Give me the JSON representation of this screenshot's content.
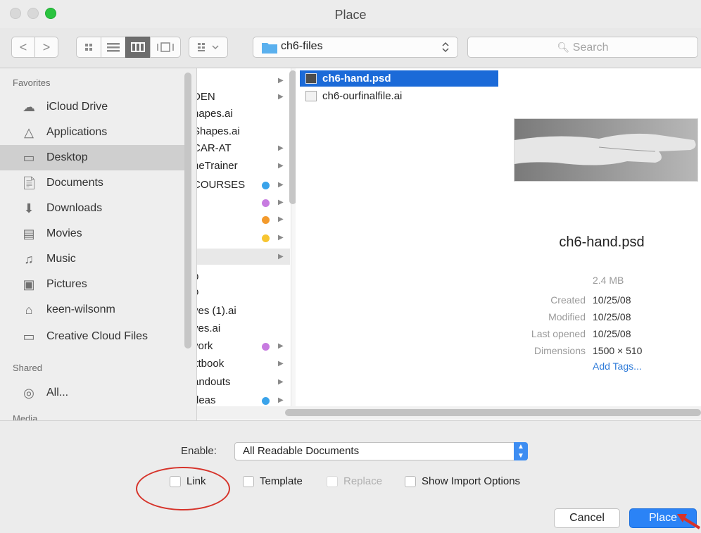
{
  "window": {
    "title": "Place"
  },
  "toolbar": {
    "back": "<",
    "forward": ">",
    "path": "ch6-files",
    "search_placeholder": "Search"
  },
  "sidebar": {
    "favorites_header": "Favorites",
    "favorites": [
      {
        "label": "iCloud Drive",
        "icon": "cloud-icon"
      },
      {
        "label": "Applications",
        "icon": "applications-icon"
      },
      {
        "label": "Desktop",
        "icon": "desktop-icon",
        "selected": true
      },
      {
        "label": "Documents",
        "icon": "documents-icon"
      },
      {
        "label": "Downloads",
        "icon": "downloads-icon"
      },
      {
        "label": "Movies",
        "icon": "movies-icon"
      },
      {
        "label": "Music",
        "icon": "music-icon"
      },
      {
        "label": "Pictures",
        "icon": "pictures-icon"
      },
      {
        "label": "keen-wilsonm",
        "icon": "home-icon"
      },
      {
        "label": "Creative Cloud Files",
        "icon": "folder-icon"
      }
    ],
    "shared_header": "Shared",
    "shared": [
      {
        "label": "All...",
        "icon": "network-icon"
      }
    ],
    "media_header": "Media"
  },
  "column1": {
    "rows": [
      {
        "text": "DEN",
        "tag": ""
      },
      {
        "text": "hapes.ai",
        "tag": ""
      },
      {
        "text": "Shapes.ai",
        "tag": ""
      },
      {
        "text": "CAR-AT",
        "tag": ""
      },
      {
        "text": "heTrainer",
        "tag": ""
      },
      {
        "text": "COURSES",
        "tag": "#3aa3ea"
      },
      {
        "text": "",
        "tag": "#c77be0"
      },
      {
        "text": "",
        "tag": "#f39a2c"
      },
      {
        "text": "",
        "tag": "#f7c531"
      },
      {
        "text": "",
        "tag": ""
      },
      {
        "text": "p",
        "tag": ""
      },
      {
        "text": "o",
        "tag": ""
      },
      {
        "text": "ves (1).ai",
        "tag": ""
      },
      {
        "text": "ves.ai",
        "tag": ""
      },
      {
        "text": "vork",
        "tag": "#c77be0"
      },
      {
        "text": "xtbook",
        "tag": ""
      },
      {
        "text": "andouts",
        "tag": ""
      },
      {
        "text": "deas",
        "tag": "#3aa3ea"
      }
    ]
  },
  "column2": {
    "files": [
      {
        "name": "ch6-hand.psd",
        "selected": true
      },
      {
        "name": "ch6-ourfinalfile.ai",
        "selected": false
      }
    ]
  },
  "preview": {
    "filename": "ch6-hand.psd",
    "size": "2.4 MB",
    "created_label": "Created",
    "created": "10/25/08",
    "modified_label": "Modified",
    "modified": "10/25/08",
    "last_opened_label": "Last opened",
    "last_opened": "10/25/08",
    "dimensions_label": "Dimensions",
    "dimensions": "1500 × 510",
    "add_tags": "Add Tags..."
  },
  "bottom": {
    "enable_label": "Enable:",
    "enable_value": "All Readable Documents",
    "link_label": "Link",
    "template_label": "Template",
    "replace_label": "Replace",
    "show_import_label": "Show Import Options",
    "cancel_label": "Cancel",
    "place_label": "Place"
  },
  "colors": {
    "accent": "#2b83f6",
    "annotation": "#d6332a"
  }
}
